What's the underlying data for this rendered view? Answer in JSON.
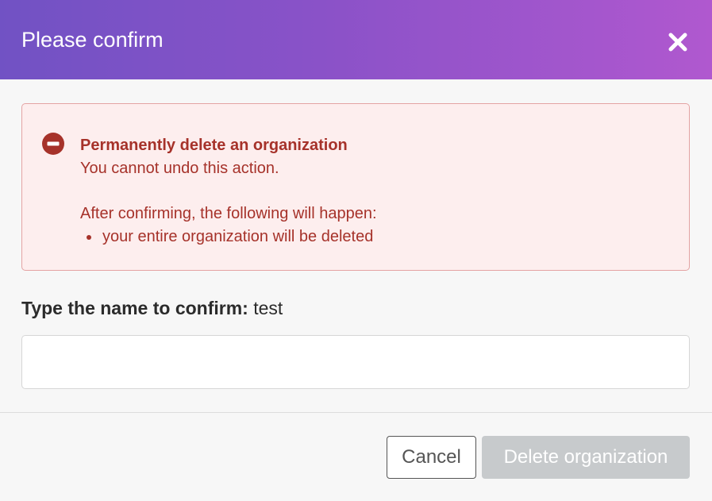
{
  "dialog": {
    "title": "Please confirm",
    "close_icon": "close-icon"
  },
  "alert": {
    "icon": "minus-circle-icon",
    "heading": "Permanently delete an organization",
    "subheading": "You cannot undo this action.",
    "consequences_intro": "After confirming, the following will happen:",
    "consequences": [
      "your entire organization will be deleted"
    ]
  },
  "confirm": {
    "label": "Type the name to confirm:",
    "name": "test",
    "input_value": "",
    "input_placeholder": ""
  },
  "footer": {
    "cancel_label": "Cancel",
    "delete_label": "Delete organization",
    "delete_enabled": false
  },
  "colors": {
    "header_gradient_start": "#7152c4",
    "header_gradient_end": "#b058cf",
    "alert_text": "#a6322a",
    "alert_background": "#fdeeee",
    "alert_border": "#e4a3a3",
    "disabled_button": "#c7cacc"
  }
}
